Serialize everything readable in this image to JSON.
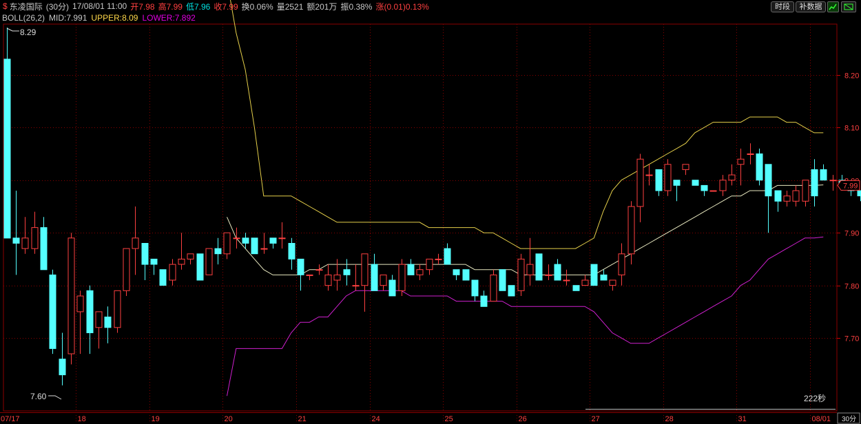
{
  "header": {
    "symbol_icon": "dollar-icon",
    "name": "东凌国际",
    "period": "(30分)",
    "datetime": "17/08/01 11:00",
    "open": "开7.98",
    "high": "高7.99",
    "low": "低7.96",
    "close": "收7.99",
    "turnover": "换0.06%",
    "volume": "量2521",
    "amount": "额201万",
    "amplitude": "振0.38%",
    "change": "涨(0.01)0.13%"
  },
  "indicator": {
    "name": "BOLL(26,2)",
    "mid": "MID:7.991",
    "upper": "UPPER:8.09",
    "lower": "LOWER:7.892"
  },
  "buttons": {
    "timeshare": "时段",
    "supplement": "补数据"
  },
  "colors": {
    "up": "#ff4040",
    "down": "#54ffff",
    "mid": "#e8e8c0",
    "upper": "#e6d04a",
    "lower": "#d020d0",
    "grid": "#8b0000"
  },
  "chart_data": {
    "type": "candlestick",
    "ylim": [
      7.589,
      8.29
    ],
    "yticks": [
      "8.20",
      "8.10",
      "8.00",
      "7.90",
      "7.80",
      "7.70"
    ],
    "max_label": "8.29",
    "min_label": "7.60",
    "last_price_label": "7.99",
    "countdown": "222秒",
    "period_label": "30分",
    "date_labels": [
      {
        "label": "07/17",
        "i": 0
      },
      {
        "label": "18",
        "i": 8
      },
      {
        "label": "19",
        "i": 16
      },
      {
        "label": "20",
        "i": 24
      },
      {
        "label": "21",
        "i": 32
      },
      {
        "label": "24",
        "i": 40
      },
      {
        "label": "25",
        "i": 48
      },
      {
        "label": "26",
        "i": 56
      },
      {
        "label": "27",
        "i": 64
      },
      {
        "label": "28",
        "i": 72
      },
      {
        "label": "31",
        "i": 80
      },
      {
        "label": "08/01",
        "i": 88
      }
    ],
    "candles": [
      [
        8.23,
        8.29,
        7.89,
        7.89
      ],
      [
        7.89,
        7.98,
        7.82,
        7.88
      ],
      [
        7.87,
        7.93,
        7.86,
        7.89
      ],
      [
        7.87,
        7.94,
        7.86,
        7.91
      ],
      [
        7.91,
        7.93,
        7.84,
        7.83
      ],
      [
        7.82,
        7.83,
        7.67,
        7.68
      ],
      [
        7.66,
        7.71,
        7.61,
        7.63
      ],
      [
        7.67,
        7.9,
        7.65,
        7.89
      ],
      [
        7.75,
        7.79,
        7.67,
        7.78
      ],
      [
        7.79,
        7.8,
        7.67,
        7.71
      ],
      [
        7.72,
        7.75,
        7.68,
        7.75
      ],
      [
        7.74,
        7.76,
        7.69,
        7.72
      ],
      [
        7.72,
        7.79,
        7.71,
        7.79
      ],
      [
        7.79,
        7.84,
        7.78,
        7.87
      ],
      [
        7.87,
        7.95,
        7.82,
        7.89
      ],
      [
        7.88,
        7.88,
        7.81,
        7.84
      ],
      [
        7.85,
        7.85,
        7.82,
        7.84
      ],
      [
        7.83,
        7.83,
        7.8,
        7.8
      ],
      [
        7.81,
        7.85,
        7.8,
        7.84
      ],
      [
        7.84,
        7.9,
        7.83,
        7.85
      ],
      [
        7.85,
        7.86,
        7.84,
        7.86
      ],
      [
        7.86,
        7.86,
        7.81,
        7.81
      ],
      [
        7.82,
        7.87,
        7.82,
        7.87
      ],
      [
        7.87,
        7.89,
        7.84,
        7.86
      ],
      [
        7.86,
        7.9,
        7.85,
        7.9
      ],
      [
        7.89,
        7.91,
        7.87,
        7.89
      ],
      [
        7.89,
        7.9,
        7.87,
        7.88
      ],
      [
        7.89,
        7.89,
        7.86,
        7.86
      ],
      [
        7.87,
        7.9,
        7.86,
        7.87
      ],
      [
        7.89,
        7.89,
        7.87,
        7.88
      ],
      [
        7.89,
        7.92,
        7.87,
        7.89
      ],
      [
        7.88,
        7.89,
        7.83,
        7.85
      ],
      [
        7.85,
        7.85,
        7.79,
        7.82
      ],
      [
        7.82,
        7.82,
        7.81,
        7.82
      ],
      [
        7.83,
        7.84,
        7.82,
        7.83
      ],
      [
        7.8,
        7.84,
        7.79,
        7.82
      ],
      [
        7.81,
        7.85,
        7.79,
        7.82
      ],
      [
        7.83,
        7.85,
        7.8,
        7.82
      ],
      [
        7.8,
        7.84,
        7.79,
        7.8
      ],
      [
        7.8,
        7.86,
        7.75,
        7.86
      ],
      [
        7.84,
        7.86,
        7.79,
        7.79
      ],
      [
        7.8,
        7.82,
        7.79,
        7.82
      ],
      [
        7.81,
        7.82,
        7.78,
        7.78
      ],
      [
        7.79,
        7.85,
        7.78,
        7.84
      ],
      [
        7.84,
        7.85,
        7.82,
        7.82
      ],
      [
        7.82,
        7.84,
        7.81,
        7.83
      ],
      [
        7.83,
        7.85,
        7.82,
        7.85
      ],
      [
        7.85,
        7.86,
        7.84,
        7.85
      ],
      [
        7.87,
        7.88,
        7.84,
        7.84
      ],
      [
        7.83,
        7.83,
        7.81,
        7.82
      ],
      [
        7.83,
        7.83,
        7.81,
        7.81
      ],
      [
        7.81,
        7.81,
        7.77,
        7.78
      ],
      [
        7.78,
        7.79,
        7.76,
        7.76
      ],
      [
        7.77,
        7.83,
        7.77,
        7.82
      ],
      [
        7.83,
        7.83,
        7.79,
        7.79
      ],
      [
        7.8,
        7.8,
        7.78,
        7.78
      ],
      [
        7.79,
        7.86,
        7.78,
        7.85
      ],
      [
        7.82,
        7.89,
        7.8,
        7.84
      ],
      [
        7.86,
        7.86,
        7.81,
        7.81
      ],
      [
        7.82,
        7.84,
        7.81,
        7.82
      ],
      [
        7.84,
        7.85,
        7.81,
        7.81
      ],
      [
        7.81,
        7.83,
        7.8,
        7.81
      ],
      [
        7.8,
        7.8,
        7.79,
        7.79
      ],
      [
        7.8,
        7.82,
        7.8,
        7.81
      ],
      [
        7.84,
        7.84,
        7.8,
        7.8
      ],
      [
        7.82,
        7.83,
        7.81,
        7.81
      ],
      [
        7.8,
        7.81,
        7.79,
        7.81
      ],
      [
        7.82,
        7.88,
        7.8,
        7.86
      ],
      [
        7.86,
        7.96,
        7.84,
        7.95
      ],
      [
        7.95,
        8.05,
        7.92,
        8.04
      ],
      [
        8.01,
        8.03,
        7.99,
        8.01
      ],
      [
        8.02,
        8.02,
        7.97,
        7.98
      ],
      [
        7.98,
        8.04,
        7.97,
        8.03
      ],
      [
        8.0,
        8.0,
        7.96,
        7.99
      ],
      [
        8.02,
        8.03,
        8.01,
        8.03
      ],
      [
        8.0,
        8.0,
        7.99,
        7.99
      ],
      [
        7.99,
        7.99,
        7.97,
        7.98
      ],
      [
        7.98,
        7.98,
        7.98,
        7.98
      ],
      [
        7.98,
        8.01,
        7.97,
        8.0
      ],
      [
        8.0,
        8.03,
        7.99,
        8.01
      ],
      [
        8.03,
        8.06,
        7.99,
        8.04
      ],
      [
        8.05,
        8.07,
        8.03,
        8.05
      ],
      [
        8.05,
        8.06,
        7.99,
        8.0
      ],
      [
        8.03,
        8.03,
        7.9,
        7.97
      ],
      [
        7.98,
        7.98,
        7.94,
        7.96
      ],
      [
        7.96,
        7.98,
        7.95,
        7.97
      ],
      [
        7.96,
        7.99,
        7.95,
        7.98
      ],
      [
        7.96,
        8.0,
        7.95,
        8.0
      ],
      [
        8.02,
        8.04,
        7.95,
        7.97
      ],
      [
        8.02,
        8.03,
        8.0,
        8.0
      ],
      [
        8.0,
        8.01,
        7.98,
        8.0
      ],
      [
        8.0,
        8.01,
        7.98,
        7.99
      ],
      [
        7.99,
        8.0,
        7.97,
        7.98
      ],
      [
        7.98,
        7.98,
        7.96,
        7.97
      ],
      [
        7.97,
        7.99,
        7.95,
        7.98
      ],
      [
        7.98,
        7.99,
        7.96,
        7.99
      ]
    ],
    "upper": [
      null,
      null,
      null,
      null,
      null,
      null,
      null,
      null,
      null,
      null,
      null,
      null,
      null,
      null,
      null,
      null,
      null,
      null,
      null,
      null,
      null,
      null,
      null,
      null,
      8.38,
      8.28,
      8.21,
      8.1,
      7.97,
      7.97,
      7.97,
      7.97,
      7.96,
      7.95,
      7.94,
      7.93,
      7.92,
      7.92,
      7.92,
      7.92,
      7.92,
      7.92,
      7.92,
      7.92,
      7.92,
      7.92,
      7.91,
      7.91,
      7.91,
      7.91,
      7.91,
      7.91,
      7.9,
      7.9,
      7.89,
      7.88,
      7.87,
      7.87,
      7.87,
      7.87,
      7.87,
      7.87,
      7.87,
      7.88,
      7.89,
      7.94,
      7.98,
      8.0,
      8.01,
      8.02,
      8.03,
      8.04,
      8.05,
      8.06,
      8.07,
      8.09,
      8.1,
      8.11,
      8.11,
      8.11,
      8.11,
      8.12,
      8.12,
      8.12,
      8.12,
      8.11,
      8.11,
      8.1,
      8.09,
      8.09
    ],
    "mid": [
      null,
      null,
      null,
      null,
      null,
      null,
      null,
      null,
      null,
      null,
      null,
      null,
      null,
      null,
      null,
      null,
      null,
      null,
      null,
      null,
      null,
      null,
      null,
      null,
      7.93,
      7.89,
      7.87,
      7.85,
      7.83,
      7.82,
      7.82,
      7.82,
      7.82,
      7.83,
      7.83,
      7.84,
      7.84,
      7.84,
      7.84,
      7.84,
      7.84,
      7.84,
      7.84,
      7.84,
      7.84,
      7.84,
      7.84,
      7.84,
      7.84,
      7.84,
      7.84,
      7.83,
      7.83,
      7.83,
      7.83,
      7.83,
      7.82,
      7.82,
      7.82,
      7.82,
      7.82,
      7.82,
      7.82,
      7.82,
      7.82,
      7.83,
      7.84,
      7.85,
      7.86,
      7.87,
      7.88,
      7.89,
      7.9,
      7.91,
      7.92,
      7.93,
      7.94,
      7.95,
      7.96,
      7.97,
      7.97,
      7.98,
      7.98,
      7.98,
      7.99,
      7.99,
      7.99,
      7.99,
      7.99,
      7.991
    ],
    "lower": [
      null,
      null,
      null,
      null,
      null,
      null,
      null,
      null,
      null,
      null,
      null,
      null,
      null,
      null,
      null,
      null,
      null,
      null,
      null,
      null,
      null,
      null,
      null,
      null,
      7.59,
      7.68,
      7.68,
      7.68,
      7.68,
      7.68,
      7.68,
      7.71,
      7.73,
      7.73,
      7.74,
      7.74,
      7.76,
      7.78,
      7.79,
      7.79,
      7.79,
      7.79,
      7.79,
      7.79,
      7.78,
      7.78,
      7.78,
      7.78,
      7.78,
      7.77,
      7.77,
      7.77,
      7.77,
      7.77,
      7.77,
      7.76,
      7.76,
      7.76,
      7.76,
      7.76,
      7.76,
      7.76,
      7.76,
      7.76,
      7.75,
      7.73,
      7.71,
      7.7,
      7.69,
      7.69,
      7.69,
      7.7,
      7.71,
      7.72,
      7.73,
      7.74,
      7.75,
      7.76,
      7.77,
      7.78,
      7.8,
      7.81,
      7.83,
      7.85,
      7.86,
      7.87,
      7.88,
      7.89,
      7.89,
      7.892
    ]
  }
}
